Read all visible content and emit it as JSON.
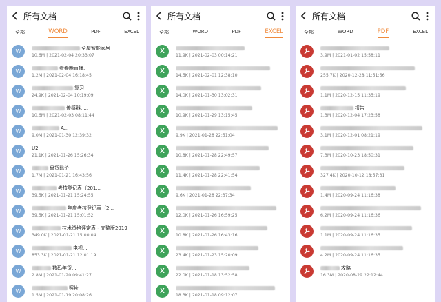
{
  "screens": [
    {
      "title": "所有文档",
      "tabs": [
        "全部",
        "WORD",
        "PDF",
        "EXCEL"
      ],
      "active_tab": 1,
      "file_type": "word",
      "icon_glyph": "W",
      "files": [
        {
          "name_suffix": "全屋智能家居",
          "meta": "10.6M | 2021-02-04 20:33:07"
        },
        {
          "name_suffix": "看春晚直播,",
          "meta": "1.2M | 2021-02-04 16:18:45"
        },
        {
          "name_suffix": "复习",
          "meta": "24.9K | 2021-02-04 10:19:09"
        },
        {
          "name_suffix": "传感器, ...",
          "meta": "10.6M | 2021-02-03 08:11:44"
        },
        {
          "name_suffix": "A...",
          "meta": "9.0M | 2021-01-30 12:39:32"
        },
        {
          "name_suffix": "U2",
          "meta": "21.1K | 2021-01-26 15:26:34"
        },
        {
          "name_suffix": "盘货比价",
          "meta": "1.7M | 2021-01-21 16:43:56"
        },
        {
          "name_suffix": "考核登记表（201...",
          "meta": "39.5K | 2021-01-21 15:24:55"
        },
        {
          "name_suffix": "年度考核登记表（2...",
          "meta": "39.5K | 2021-01-21 15:01:52"
        },
        {
          "name_suffix": "技术资格评定表 - 完整版2019",
          "meta": "349.0K | 2021-01-21 15:00:04"
        },
        {
          "name_suffix": "电视...",
          "meta": "853.3K | 2021-01-21 12:01:19"
        },
        {
          "name_suffix": "数码年货...",
          "meta": "2.8M | 2021-01-20 09:41:27"
        },
        {
          "name_suffix": "照片",
          "meta": "1.5M | 2021-01-19 20:08:26"
        }
      ]
    },
    {
      "title": "所有文档",
      "tabs": [
        "全部",
        "WORD",
        "PDF",
        "EXCEL"
      ],
      "active_tab": 3,
      "file_type": "excel",
      "icon_glyph": "X",
      "files": [
        {
          "name_suffix": "",
          "meta": "11.9K | 2021-02-03 00:14:21"
        },
        {
          "name_suffix": "",
          "meta": "14.5K | 2021-02-01 12:38:10"
        },
        {
          "name_suffix": "",
          "meta": "14.0K | 2021-01-30 13:02:31"
        },
        {
          "name_suffix": "",
          "meta": "10.9K | 2021-01-29 13:15:45"
        },
        {
          "name_suffix": "",
          "meta": "9.9K | 2021-01-28 22:51:04"
        },
        {
          "name_suffix": "",
          "meta": "10.8K | 2021-01-28 22:49:57"
        },
        {
          "name_suffix": "",
          "meta": "11.4K | 2021-01-28 22:41:54"
        },
        {
          "name_suffix": "",
          "meta": "9.6K | 2021-01-28 22:37:34"
        },
        {
          "name_suffix": "",
          "meta": "12.0K | 2021-01-26 16:59:25"
        },
        {
          "name_suffix": "",
          "meta": "10.8K | 2021-01-26 16:43:16"
        },
        {
          "name_suffix": "",
          "meta": "23.4K | 2021-01-23 15:20:09"
        },
        {
          "name_suffix": "",
          "meta": "22.0K | 2021-01-18 13:52:58"
        },
        {
          "name_suffix": "",
          "meta": "18.3K | 2021-01-18 09:12:07"
        }
      ]
    },
    {
      "title": "所有文档",
      "tabs": [
        "全部",
        "WORD",
        "PDF",
        "EXCEL"
      ],
      "active_tab": 2,
      "file_type": "pdf",
      "icon_glyph": "P",
      "files": [
        {
          "name_suffix": "",
          "meta": "3.9M | 2021-01-02 15:58:11"
        },
        {
          "name_suffix": "",
          "meta": "255.7K | 2020-12-28 11:51:56"
        },
        {
          "name_suffix": "",
          "meta": "1.1M | 2020-12-15 11:35:19"
        },
        {
          "name_suffix": "报告",
          "meta": "1.3M | 2020-12-04 17:23:58"
        },
        {
          "name_suffix": "",
          "meta": "3.1M | 2020-12-01 08:21:19"
        },
        {
          "name_suffix": "",
          "meta": "7.3M | 2020-10-23 18:50:31"
        },
        {
          "name_suffix": "",
          "meta": "327.4K | 2020-10-12 18:57:31"
        },
        {
          "name_suffix": "",
          "meta": "1.4M | 2020-09-24 11:16:38"
        },
        {
          "name_suffix": "",
          "meta": "6.2M | 2020-09-24 11:16:36"
        },
        {
          "name_suffix": "",
          "meta": "1.1M | 2020-09-24 11:16:35"
        },
        {
          "name_suffix": "",
          "meta": "4.2M | 2020-09-24 11:16:35"
        },
        {
          "name_suffix": "攻略",
          "meta": "16.3M | 2020-08-29 22:12:44"
        }
      ]
    }
  ],
  "colors": {
    "accent": "#f08a3b",
    "word": "#7aa7d6",
    "excel": "#3ea35a",
    "pdf": "#c93a33",
    "background": "#ddd6f5"
  },
  "icons": {
    "back": "back-arrow-icon",
    "search": "search-icon",
    "more": "more-vertical-icon"
  }
}
